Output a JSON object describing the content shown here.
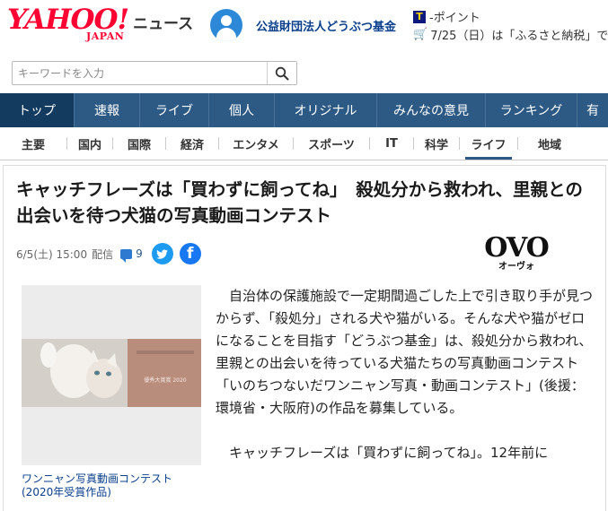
{
  "header": {
    "logo_main": "YAHOO!",
    "logo_sub": "JAPAN",
    "service_name": "ニュース",
    "user_name": "公益財団法人どうぶつ基金",
    "points_label": "-ポイント",
    "points_icon": "T",
    "promo_text": "7/25（日）は「ふるさと納税」で"
  },
  "search": {
    "placeholder": "キーワードを入力"
  },
  "main_nav": {
    "items": [
      "トップ",
      "速報",
      "ライブ",
      "個人",
      "オリジナル",
      "みんなの意見",
      "ランキング",
      "有"
    ],
    "active": "トップ"
  },
  "sub_nav": {
    "items": [
      "主要",
      "国内",
      "国際",
      "経済",
      "エンタメ",
      "スポーツ",
      "IT",
      "科学",
      "ライフ",
      "地域"
    ],
    "active": "ライフ"
  },
  "article": {
    "title": "キャッチフレーズは「買わずに飼ってね」　殺処分から救われ、里親との出会いを待つ犬猫の写真動画コンテスト",
    "date": "6/5(土) 15:00",
    "date_suffix": "配信",
    "comment_count": "9",
    "publisher_logo": "OVO",
    "publisher_logo_sub": "オーヴォ",
    "photo_caption": "ワンニャン写真動画コンテスト(2020年受賞作品)",
    "photo_overlay_text": "優秀大賞賞 2020",
    "paragraphs": [
      "自治体の保護施設で一定期間過ごした上で引き取り手が見つからず、「殺処分」される犬や猫がいる。そんな犬や猫がゼロになることを目指す「どうぶつ基金」は、殺処分から救われ、里親との出会いを待っている犬猫たちの写真動画コンテスト「いのちつないだワンニャン写真・動画コンテスト」(後援：環境省・大阪府)の作品を募集している。",
      "キャッチフレーズは「買わずに飼ってね」。12年前に"
    ]
  },
  "colors": {
    "brand_red": "#ff0033",
    "nav_bg": "#2d5a85",
    "nav_active": "#133a5f",
    "link_blue": "#0a3f8c",
    "twitter": "#1d9bf0",
    "facebook": "#1877f2"
  }
}
